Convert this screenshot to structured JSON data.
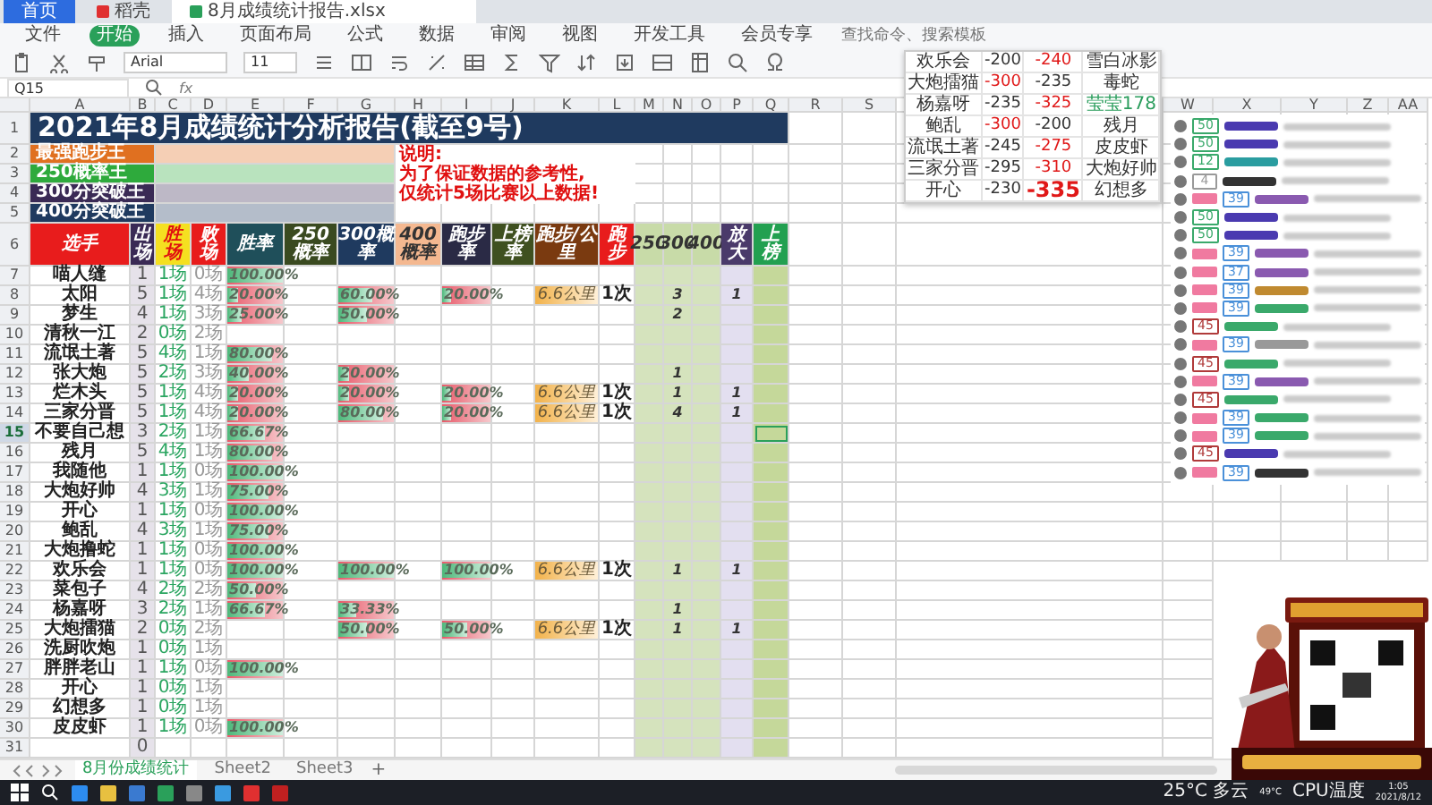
{
  "app_tabs": [
    {
      "label": "首页",
      "selected": false,
      "kind": "home"
    },
    {
      "label": "稻壳",
      "selected": false,
      "kind": "docer"
    },
    {
      "label": "8月成绩统计报告.xlsx",
      "selected": true,
      "kind": "sheet"
    }
  ],
  "menu": [
    {
      "label": "文件",
      "selected": false
    },
    {
      "label": "开始",
      "selected": true
    },
    {
      "label": "插入",
      "selected": false
    },
    {
      "label": "页面布局",
      "selected": false
    },
    {
      "label": "公式",
      "selected": false
    },
    {
      "label": "数据",
      "selected": false
    },
    {
      "label": "审阅",
      "selected": false
    },
    {
      "label": "视图",
      "selected": false
    },
    {
      "label": "开发工具",
      "selected": false
    },
    {
      "label": "会员专享",
      "selected": false
    }
  ],
  "search": {
    "placeholder": "查找命令、搜索模板"
  },
  "ribbon": {
    "font": "Arial",
    "size": "11"
  },
  "formula_bar": {
    "cell": "Q15",
    "fx": "fx"
  },
  "columns": [
    "A",
    "B",
    "C",
    "D",
    "E",
    "F",
    "G",
    "H",
    "I",
    "J",
    "K",
    "L",
    "M",
    "N",
    "O",
    "P",
    "Q",
    "R",
    "S"
  ],
  "right_columns": [
    "W",
    "X",
    "Y",
    "Z",
    "AA"
  ],
  "row_numbers": [
    "1",
    "2",
    "3",
    "4",
    "5",
    "6"
  ],
  "title": "2021年8月成绩统计分析报告(截至9号)",
  "awards": [
    {
      "label": "最强跑步王",
      "color": "#e07020"
    },
    {
      "label": "250概率王",
      "color": "#2eaa3c"
    },
    {
      "label": "300分突破王",
      "color": "#3a2a55"
    },
    {
      "label": "400分突破王",
      "color": "#1f3a5f"
    }
  ],
  "note": [
    "说明:",
    "为了保证数据的参考性,",
    "仅统计5场比赛以上数据!"
  ],
  "headers": [
    {
      "label": "选手",
      "color": "#e81c1c"
    },
    {
      "label": "出场",
      "color": "#3a2a55"
    },
    {
      "label": "胜场",
      "color": "#f5e020"
    },
    {
      "label": "败场",
      "color": "#e81c1c"
    },
    {
      "label": "胜率",
      "color": "#1f4f5a"
    },
    {
      "label": "250概率",
      "color": "#3a4a20"
    },
    {
      "label": "300概率",
      "color": "#1f3a5f"
    },
    {
      "label": "400概率",
      "color": "#f4b890"
    },
    {
      "label": "跑步率",
      "color": "#2a2a45"
    },
    {
      "label": "上榜率",
      "color": "#3f5020"
    },
    {
      "label": "跑步/公里",
      "color": "#7a3a10"
    },
    {
      "label": "跑步",
      "color": "#e81c1c"
    },
    {
      "label": "250",
      "color": "#c8dba8"
    },
    {
      "label": "300",
      "color": "#c8dba8"
    },
    {
      "label": "400",
      "color": "#c8dba8"
    },
    {
      "label": "放大",
      "color": "#4a3a6a"
    },
    {
      "label": "上榜",
      "color": "#22a050"
    }
  ],
  "players": [
    {
      "num": "7",
      "selected": false,
      "name": "喵人缝",
      "played": "1",
      "won": "1场",
      "lost": "0场",
      "win_rate": {
        "text": "100.00%",
        "level": 1
      }
    },
    {
      "num": "8",
      "selected": false,
      "name": "太阳",
      "played": "5",
      "won": "1场",
      "lost": "4场",
      "win_rate": {
        "text": "20.00%",
        "level": 0.2
      },
      "p300": {
        "text": "60.00%",
        "level": 0.6
      },
      "run_rate": {
        "text": "20.00%",
        "level": 0.2
      },
      "run_km": "6.6公里",
      "runs": "1次",
      "c300": "3",
      "zoom": "1"
    },
    {
      "num": "9",
      "selected": false,
      "name": "梦生",
      "played": "4",
      "won": "1场",
      "lost": "3场",
      "win_rate": {
        "text": "25.00%",
        "level": 0.25
      },
      "p300": {
        "text": "50.00%",
        "level": 0.5
      },
      "c300": "2"
    },
    {
      "num": "10",
      "selected": false,
      "name": "清秋一江",
      "played": "2",
      "won": "0场",
      "lost": "2场"
    },
    {
      "num": "11",
      "selected": false,
      "name": "流氓土著",
      "played": "5",
      "won": "4场",
      "lost": "1场",
      "win_rate": {
        "text": "80.00%",
        "level": 0.8
      }
    },
    {
      "num": "12",
      "selected": false,
      "name": "张大炮",
      "played": "5",
      "won": "2场",
      "lost": "3场",
      "win_rate": {
        "text": "40.00%",
        "level": 0.4
      },
      "p300": {
        "text": "20.00%",
        "level": 0.2
      },
      "c300": "1"
    },
    {
      "num": "13",
      "selected": false,
      "name": "烂木头",
      "played": "5",
      "won": "1场",
      "lost": "4场",
      "win_rate": {
        "text": "20.00%",
        "level": 0.2
      },
      "p300": {
        "text": "20.00%",
        "level": 0.2
      },
      "run_rate": {
        "text": "20.00%",
        "level": 0.2
      },
      "run_km": "6.6公里",
      "runs": "1次",
      "c300": "1",
      "zoom": "1"
    },
    {
      "num": "14",
      "selected": false,
      "name": "三家分晋",
      "played": "5",
      "won": "1场",
      "lost": "4场",
      "win_rate": {
        "text": "20.00%",
        "level": 0.2
      },
      "p300": {
        "text": "80.00%",
        "level": 0.8
      },
      "run_rate": {
        "text": "20.00%",
        "level": 0.2
      },
      "run_km": "6.6公里",
      "runs": "1次",
      "c300": "4",
      "zoom": "1"
    },
    {
      "num": "15",
      "selected": true,
      "name": "不要自己想",
      "played": "3",
      "won": "2场",
      "lost": "1场",
      "win_rate": {
        "text": "66.67%",
        "level": 0.6667
      }
    },
    {
      "num": "16",
      "selected": false,
      "name": "残月",
      "played": "5",
      "won": "4场",
      "lost": "1场",
      "win_rate": {
        "text": "80.00%",
        "level": 0.8
      }
    },
    {
      "num": "17",
      "selected": false,
      "name": "我随他",
      "played": "1",
      "won": "1场",
      "lost": "0场",
      "win_rate": {
        "text": "100.00%",
        "level": 1
      }
    },
    {
      "num": "18",
      "selected": false,
      "name": "大炮好帅",
      "played": "4",
      "won": "3场",
      "lost": "1场",
      "win_rate": {
        "text": "75.00%",
        "level": 0.75
      }
    },
    {
      "num": "19",
      "selected": false,
      "name": "开心",
      "played": "1",
      "won": "1场",
      "lost": "0场",
      "win_rate": {
        "text": "100.00%",
        "level": 1
      }
    },
    {
      "num": "20",
      "selected": false,
      "name": "鲍乱",
      "played": "4",
      "won": "3场",
      "lost": "1场",
      "win_rate": {
        "text": "75.00%",
        "level": 0.75
      }
    },
    {
      "num": "21",
      "selected": false,
      "name": "大炮撸蛇",
      "played": "1",
      "won": "1场",
      "lost": "0场",
      "win_rate": {
        "text": "100.00%",
        "level": 1
      }
    },
    {
      "num": "22",
      "selected": false,
      "name": "欢乐会",
      "played": "1",
      "won": "1场",
      "lost": "0场",
      "win_rate": {
        "text": "100.00%",
        "level": 1
      },
      "p300": {
        "text": "100.00%",
        "level": 1
      },
      "run_rate": {
        "text": "100.00%",
        "level": 1
      },
      "run_km": "6.6公里",
      "runs": "1次",
      "c300": "1",
      "zoom": "1"
    },
    {
      "num": "23",
      "selected": false,
      "name": "菜包子",
      "played": "4",
      "won": "2场",
      "lost": "2场",
      "win_rate": {
        "text": "50.00%",
        "level": 0.5
      }
    },
    {
      "num": "24",
      "selected": false,
      "name": "杨嘉呀",
      "played": "3",
      "won": "2场",
      "lost": "1场",
      "win_rate": {
        "text": "66.67%",
        "level": 0.6667
      },
      "p300": {
        "text": "33.33%",
        "level": 0.3333
      },
      "c300": "1"
    },
    {
      "num": "25",
      "selected": false,
      "name": "大炮擂猫",
      "played": "2",
      "won": "0场",
      "lost": "2场",
      "p300": {
        "text": "50.00%",
        "level": 0.5
      },
      "run_rate": {
        "text": "50.00%",
        "level": 0.5
      },
      "run_km": "6.6公里",
      "runs": "1次",
      "c300": "1",
      "zoom": "1"
    },
    {
      "num": "26",
      "selected": false,
      "name": "洗厨吹炮",
      "played": "1",
      "won": "0场",
      "lost": "1场"
    },
    {
      "num": "27",
      "selected": false,
      "name": "胖胖老山",
      "played": "1",
      "won": "1场",
      "lost": "0场",
      "win_rate": {
        "text": "100.00%",
        "level": 1
      }
    },
    {
      "num": "28",
      "selected": false,
      "name": "开心",
      "played": "1",
      "won": "0场",
      "lost": "1场"
    },
    {
      "num": "29",
      "selected": false,
      "name": "幻想多",
      "played": "1",
      "won": "0场",
      "lost": "1场"
    },
    {
      "num": "30",
      "selected": false,
      "name": "皮皮虾",
      "played": "1",
      "won": "1场",
      "lost": "0场",
      "win_rate": {
        "text": "100.00%",
        "level": 1
      }
    },
    {
      "num": "31",
      "selected": false,
      "played": "0"
    }
  ],
  "scoreboard": [
    {
      "name": "欢乐会",
      "a": "-200",
      "b": "-240",
      "other": "雪白冰影",
      "a_highlighted": false,
      "b_highlighted": true,
      "color": "#333333",
      "large": false
    },
    {
      "name": "大炮擂猫",
      "a": "-300",
      "b": "-235",
      "other": "毒蛇",
      "a_highlighted": true,
      "b_highlighted": false,
      "color": "#333333",
      "large": false
    },
    {
      "name": "杨嘉呀",
      "a": "-235",
      "b": "-325",
      "other": "莹莹178",
      "a_highlighted": false,
      "b_highlighted": true,
      "color": "#2a9d5c",
      "large": false
    },
    {
      "name": "鲍乱",
      "a": "-300",
      "b": "-200",
      "other": "残月",
      "a_highlighted": true,
      "b_highlighted": false,
      "color": "#333333",
      "large": false
    },
    {
      "name": "流氓土著",
      "a": "-245",
      "b": "-275",
      "other": "皮皮虾",
      "a_highlighted": false,
      "b_highlighted": true,
      "color": "#333333",
      "large": false
    },
    {
      "name": "三家分晋",
      "a": "-295",
      "b": "-310",
      "other": "大炮好帅",
      "a_highlighted": false,
      "b_highlighted": true,
      "color": "#333333",
      "large": false
    },
    {
      "name": "开心",
      "a": "-230",
      "b": "-335",
      "other": "幻想多",
      "a_highlighted": false,
      "b_highlighted": true,
      "color": "#333333",
      "large": true
    }
  ],
  "chat": [
    {
      "fan": false,
      "level": "50",
      "kind": "veteran",
      "color": "#4a3ab0"
    },
    {
      "fan": false,
      "level": "50",
      "kind": "veteran",
      "color": "#4a3ab0"
    },
    {
      "fan": false,
      "level": "12",
      "kind": "veteran",
      "color": "#2a9da0"
    },
    {
      "fan": false,
      "level": "4",
      "kind": "newcomer",
      "color": "#333333"
    },
    {
      "fan": true,
      "level": "39",
      "kind": "member",
      "color": "#8a5ab0"
    },
    {
      "fan": false,
      "level": "50",
      "kind": "veteran",
      "color": "#4a3ab0"
    },
    {
      "fan": false,
      "level": "50",
      "kind": "veteran",
      "color": "#4a3ab0"
    },
    {
      "fan": true,
      "level": "39",
      "kind": "member",
      "color": "#8a5ab0"
    },
    {
      "fan": true,
      "level": "37",
      "kind": "member",
      "color": "#8a5ab0"
    },
    {
      "fan": true,
      "level": "39",
      "kind": "member",
      "color": "#c08a30"
    },
    {
      "fan": true,
      "level": "39",
      "kind": "member",
      "color": "#3aa96b"
    },
    {
      "fan": false,
      "level": "45",
      "kind": "elder",
      "color": "#3aa96b"
    },
    {
      "fan": true,
      "level": "39",
      "kind": "member",
      "color": "#999999"
    },
    {
      "fan": false,
      "level": "45",
      "kind": "elder",
      "color": "#3aa96b"
    },
    {
      "fan": true,
      "level": "39",
      "kind": "member",
      "color": "#8a5ab0"
    },
    {
      "fan": false,
      "level": "45",
      "kind": "elder",
      "color": "#3aa96b"
    },
    {
      "fan": true,
      "level": "39",
      "kind": "member",
      "color": "#3aa96b"
    },
    {
      "fan": true,
      "level": "39",
      "kind": "member",
      "color": "#3aa96b"
    },
    {
      "fan": false,
      "level": "45",
      "kind": "elder",
      "color": "#4a3ab0"
    },
    {
      "fan": true,
      "level": "39",
      "kind": "member",
      "color": "#333333"
    }
  ],
  "sheet_tabs": [
    {
      "label": "8月份成绩统计",
      "selected": true
    },
    {
      "label": "Sheet2",
      "selected": false
    },
    {
      "label": "Sheet3",
      "selected": false
    }
  ],
  "add_sheet": "+",
  "taskbar": {
    "weather": "25°C 多云",
    "cpu_temp": "49°C",
    "cpu_label": "CPU温度",
    "time": "1:05",
    "date": "2021/8/12"
  }
}
